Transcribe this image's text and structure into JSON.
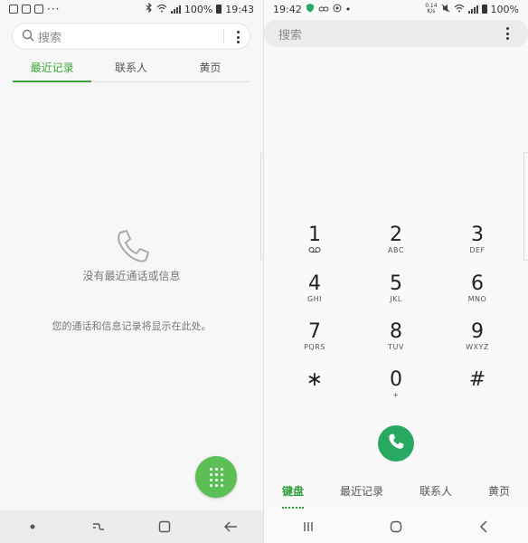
{
  "left": {
    "statusbar": {
      "battery": "100%",
      "time": "19:43",
      "more": "···"
    },
    "search": {
      "placeholder": "搜索"
    },
    "tabs": [
      {
        "label": "最近记录",
        "active": true
      },
      {
        "label": "联系人",
        "active": false
      },
      {
        "label": "黄页",
        "active": false
      }
    ],
    "empty": {
      "title": "没有最近通话或信息",
      "description": "您的通话和信息记录将显示在此处。"
    }
  },
  "right": {
    "statusbar": {
      "time": "19:42",
      "battery": "100%",
      "dot": "•",
      "data_rate_top": "0.14",
      "data_rate_bottom": "K/s"
    },
    "search": {
      "placeholder": "搜索"
    },
    "keypad": [
      {
        "digit": "1",
        "letters": ""
      },
      {
        "digit": "2",
        "letters": "ABC"
      },
      {
        "digit": "3",
        "letters": "DEF"
      },
      {
        "digit": "4",
        "letters": "GHI"
      },
      {
        "digit": "5",
        "letters": "JKL"
      },
      {
        "digit": "6",
        "letters": "MNO"
      },
      {
        "digit": "7",
        "letters": "PQRS"
      },
      {
        "digit": "8",
        "letters": "TUV"
      },
      {
        "digit": "9",
        "letters": "WXYZ"
      },
      {
        "digit": "∗",
        "letters": ""
      },
      {
        "digit": "0",
        "letters": "+"
      },
      {
        "digit": "#",
        "letters": ""
      }
    ],
    "bottom_tabs": [
      {
        "label": "键盘",
        "active": true
      },
      {
        "label": "最近记录",
        "active": false
      },
      {
        "label": "联系人",
        "active": false
      },
      {
        "label": "黄页",
        "active": false
      }
    ]
  },
  "colors": {
    "accent_green": "#3aa43a",
    "fab_green": "#5bbf55",
    "call_green": "#28a860"
  },
  "icons": {
    "left_statusbar": [
      "bag-icon",
      "cat-icon",
      "cat-icon-2",
      "bluetooth-icon",
      "wifi-icon",
      "signal-icon",
      "battery-icon"
    ],
    "empty_state": "phone-icon",
    "fab": "dialpad-icon",
    "right_statusbar": [
      "shield-icon",
      "link-icon",
      "target-icon",
      "mute-icon",
      "wifi-icon",
      "signal-icon",
      "battery-icon"
    ],
    "voicemail": "voicemail-icon",
    "call": "phone-call-icon",
    "nav_left": [
      "dot-icon",
      "recents-icon",
      "home-icon",
      "back-icon"
    ],
    "nav_right": [
      "recents-icon",
      "home-icon",
      "back-icon"
    ]
  }
}
